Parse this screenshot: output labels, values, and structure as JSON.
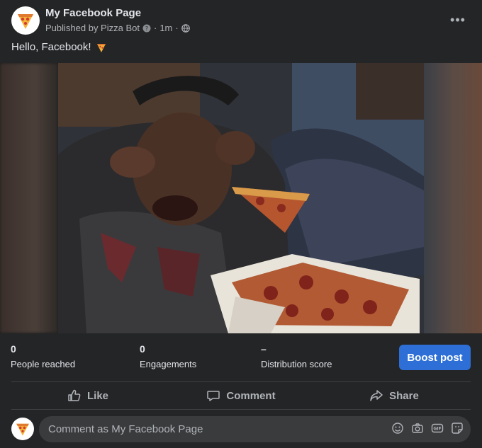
{
  "post": {
    "page_name": "My Facebook Page",
    "published_by": "Published by Pizza Bot",
    "time": "1m",
    "separator": "·",
    "text": "Hello, Facebook!",
    "more_label": "•••"
  },
  "stats": {
    "reached": {
      "value": "0",
      "label": "People reached"
    },
    "engagements": {
      "value": "0",
      "label": "Engagements"
    },
    "distribution": {
      "value": "–",
      "label": "Distribution score"
    },
    "boost_label": "Boost post"
  },
  "actions": {
    "like": "Like",
    "comment": "Comment",
    "share": "Share"
  },
  "composer": {
    "placeholder": "Comment as My Facebook Page",
    "tools": [
      "emoji-icon",
      "camera-icon",
      "gif-icon",
      "sticker-icon"
    ]
  },
  "colors": {
    "background": "#242526",
    "boost": "#2d6fd6",
    "text": "#e4e6eb",
    "muted": "#b0b3b8"
  }
}
